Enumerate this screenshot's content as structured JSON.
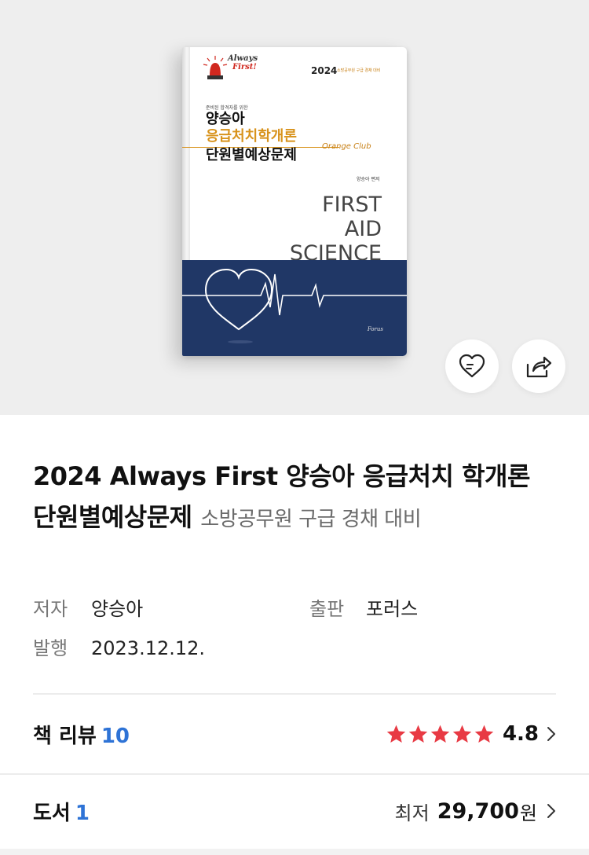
{
  "cover": {
    "logo_line1": "Always",
    "logo_line2": "First!",
    "year": "2024",
    "year_sub": "소방공무원 구급 경채 대비",
    "pre_title": "준비된 합격자를 위한",
    "title_line1": "양승아",
    "title_line2": "응급처치학개론",
    "title_line3": "단원별예상문제",
    "series": "Orange Club",
    "author_small": "양승아 편저",
    "english_1": "FIRST",
    "english_2": "AID",
    "english_3": "SCIENCE",
    "publisher_mark": "Forus",
    "colors": {
      "navy": "#203766",
      "orange": "#d8931c"
    }
  },
  "actions": {
    "wish_icon": "heart-icon",
    "share_icon": "share-icon"
  },
  "product": {
    "title_main": "2024 Always First 양승아 응급처치 학개론 단원별예상문제",
    "title_sub": "소방공무원 구급 경채 대비",
    "author_label": "저자",
    "author": "양승아",
    "publisher_label": "출판",
    "publisher": "포러스",
    "date_label": "발행",
    "date": "2023.12.12."
  },
  "review": {
    "label": "책 리뷰",
    "count": "10",
    "rating": "4.8",
    "stars": 5,
    "star_color": "#e83a44"
  },
  "books": {
    "label": "도서",
    "count": "1",
    "price_label": "최저",
    "price": "29,700",
    "currency": "원"
  }
}
